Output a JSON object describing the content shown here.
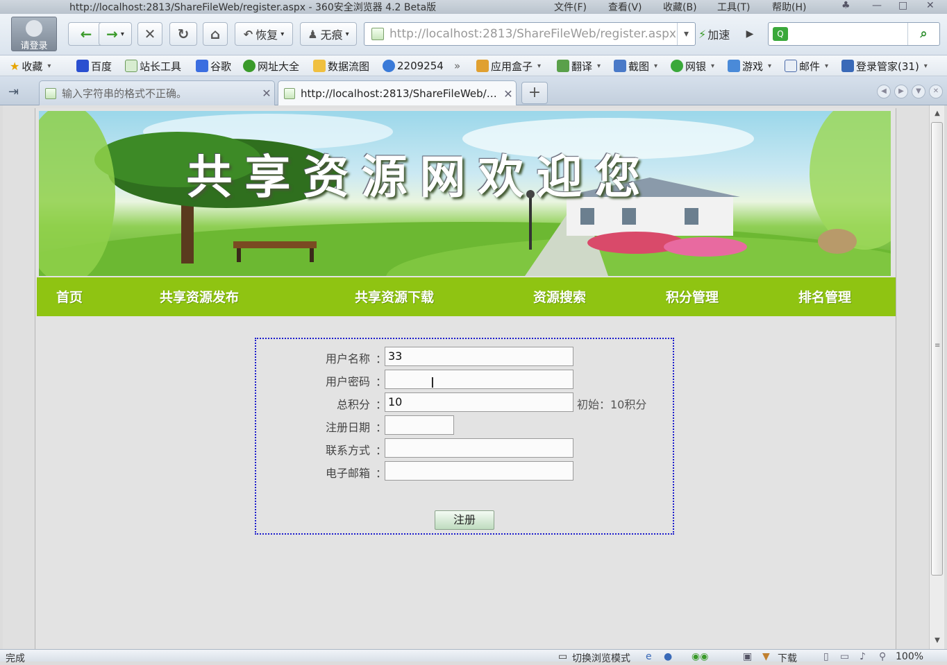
{
  "window": {
    "title": "http://localhost:2813/ShareFileWeb/register.aspx - 360安全浏览器 4.2 Beta版",
    "menus": [
      "文件(F)",
      "查看(V)",
      "收藏(B)",
      "工具(T)",
      "帮助(H)"
    ]
  },
  "toolbar": {
    "login_label": "请登录",
    "restore_label": "恢复",
    "incognito_label": "无痕",
    "address_url": "http://localhost:2813/ShareFileWeb/register.aspx",
    "speed_label": "加速"
  },
  "favorites": {
    "collect_label": "收藏",
    "items": [
      "百度",
      "站长工具",
      "谷歌",
      "网址大全",
      "数据流图",
      "2209254",
      "应用盒子",
      "翻译",
      "截图",
      "网银",
      "游戏",
      "邮件",
      "登录管家(31)"
    ]
  },
  "tabs": [
    {
      "label": "输入字符串的格式不正确。",
      "active": false
    },
    {
      "label": "http://localhost:2813/ShareFileWeb/register.aspx",
      "active": true
    }
  ],
  "site": {
    "banner_title": "共享资源网欢迎您",
    "nav": [
      "首页",
      "共享资源发布",
      "共享资源下载",
      "资源搜索",
      "积分管理",
      "排名管理"
    ]
  },
  "form": {
    "fields": [
      {
        "label": "用户名称",
        "value": "33"
      },
      {
        "label": "用户密码",
        "value": ""
      },
      {
        "label": "总积分",
        "value": "10",
        "hint": "初始：10积分"
      },
      {
        "label": "注册日期",
        "value": ""
      },
      {
        "label": "联系方式",
        "value": ""
      },
      {
        "label": "电子邮箱",
        "value": ""
      }
    ],
    "colon": "：",
    "submit_label": "注册"
  },
  "statusbar": {
    "status_text": "完成",
    "switch_mode_label": "切换浏览模式",
    "download_label": "下载",
    "zoom": "100%"
  }
}
